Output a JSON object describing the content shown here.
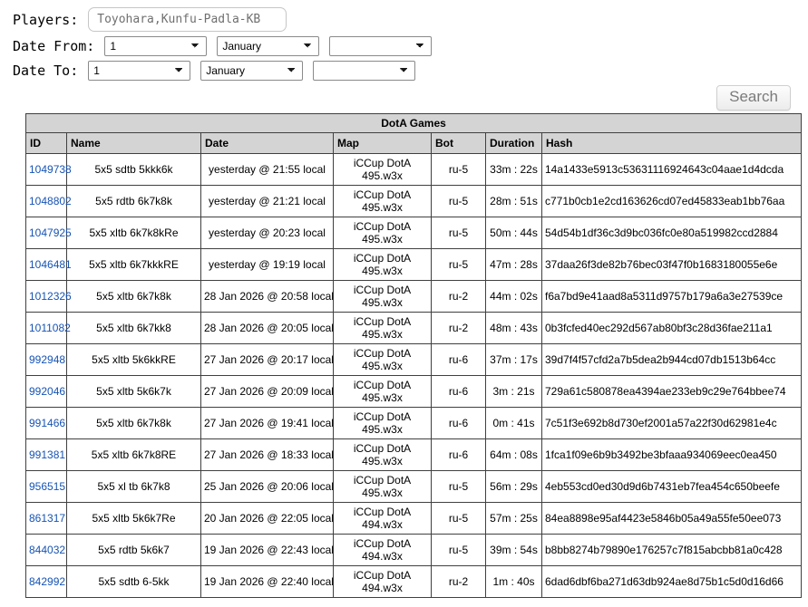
{
  "form": {
    "players": {
      "label": "Players:",
      "value": "Toyohara,Kunfu-Padla-KB"
    },
    "date_from": {
      "label": "Date From:",
      "day": "1",
      "month": "January",
      "year": ""
    },
    "date_to": {
      "label": "Date To:",
      "day": "1",
      "month": "January",
      "year": ""
    },
    "search_button": "Search"
  },
  "table": {
    "title": "DotA Games",
    "columns": [
      "ID",
      "Name",
      "Date",
      "Map",
      "Bot",
      "Duration",
      "Hash"
    ],
    "rows": [
      {
        "id": "1049738",
        "name": "5x5 sdtb 5kkk6k",
        "date": "yesterday @ 21:55 local",
        "map": "iCCup DotA 495.w3x",
        "bot": "ru-5",
        "duration": "33m : 22s",
        "hash": "14a1433e5913c53631116924643c04aae1d4dcda"
      },
      {
        "id": "1048802",
        "name": "5x5 rdtb 6k7k8k",
        "date": "yesterday @ 21:21 local",
        "map": "iCCup DotA 495.w3x",
        "bot": "ru-5",
        "duration": "28m : 51s",
        "hash": "c771b0cb1e2cd163626cd07ed45833eab1bb76aa"
      },
      {
        "id": "1047925",
        "name": "5x5 xltb 6k7k8kRe",
        "date": "yesterday @ 20:23 local",
        "map": "iCCup DotA 495.w3x",
        "bot": "ru-5",
        "duration": "50m : 44s",
        "hash": "54d54b1df36c3d9bc036fc0e80a519982ccd2884"
      },
      {
        "id": "1046481",
        "name": "5x5 xltb 6k7kkkRE",
        "date": "yesterday @ 19:19 local",
        "map": "iCCup DotA 495.w3x",
        "bot": "ru-5",
        "duration": "47m : 28s",
        "hash": "37daa26f3de82b76bec03f47f0b1683180055e6e"
      },
      {
        "id": "1012326",
        "name": "5x5 xltb 6k7k8k",
        "date": "28 Jan 2026 @ 20:58 local",
        "map": "iCCup DotA 495.w3x",
        "bot": "ru-2",
        "duration": "44m : 02s",
        "hash": "f6a7bd9e41aad8a5311d9757b179a6a3e27539ce"
      },
      {
        "id": "1011082",
        "name": "5x5 xltb 6k7kk8",
        "date": "28 Jan 2026 @ 20:05 local",
        "map": "iCCup DotA 495.w3x",
        "bot": "ru-2",
        "duration": "48m : 43s",
        "hash": "0b3fcfed40ec292d567ab80bf3c28d36fae211a1"
      },
      {
        "id": "992948",
        "name": "5x5 xltb 5k6kkRE",
        "date": "27 Jan 2026 @ 20:17 local",
        "map": "iCCup DotA 495.w3x",
        "bot": "ru-6",
        "duration": "37m : 17s",
        "hash": "39d7f4f57cfd2a7b5dea2b944cd07db1513b64cc"
      },
      {
        "id": "992046",
        "name": "5x5 xltb 5k6k7k",
        "date": "27 Jan 2026 @ 20:09 local",
        "map": "iCCup DotA 495.w3x",
        "bot": "ru-6",
        "duration": "3m : 21s",
        "hash": "729a61c580878ea4394ae233eb9c29e764bbee74"
      },
      {
        "id": "991466",
        "name": "5x5 xltb 6k7k8k",
        "date": "27 Jan 2026 @ 19:41 local",
        "map": "iCCup DotA 495.w3x",
        "bot": "ru-6",
        "duration": "0m : 41s",
        "hash": "7c51f3e692b8d730ef2001a57a22f30d62981e4c"
      },
      {
        "id": "991381",
        "name": "5x5 xltb 6k7k8RE",
        "date": "27 Jan 2026 @ 18:33 local",
        "map": "iCCup DotA 495.w3x",
        "bot": "ru-6",
        "duration": "64m : 08s",
        "hash": "1fca1f09e6b9b3492be3bfaaa934069eec0ea450"
      },
      {
        "id": "956515",
        "name": "5x5 xl tb 6k7k8",
        "date": "25 Jan 2026 @ 20:06 local",
        "map": "iCCup DotA 495.w3x",
        "bot": "ru-5",
        "duration": "56m : 29s",
        "hash": "4eb553cd0ed30d9d6b7431eb7fea454c650beefe"
      },
      {
        "id": "861317",
        "name": "5x5 xltb 5k6k7Re",
        "date": "20 Jan 2026 @ 22:05 local",
        "map": "iCCup DotA 494.w3x",
        "bot": "ru-5",
        "duration": "57m : 25s",
        "hash": "84ea8898e95af4423e5846b05a49a55fe50ee073"
      },
      {
        "id": "844032",
        "name": "5x5 rdtb 5k6k7",
        "date": "19 Jan 2026 @ 22:43 local",
        "map": "iCCup DotA 494.w3x",
        "bot": "ru-5",
        "duration": "39m : 54s",
        "hash": "b8bb8274b79890e176257c7f815abcbb81a0c428"
      },
      {
        "id": "842992",
        "name": "5x5 sdtb 6-5kk",
        "date": "19 Jan 2026 @ 22:40 local",
        "map": "iCCup DotA 494.w3x",
        "bot": "ru-2",
        "duration": "1m : 40s",
        "hash": "6dad6dbf6ba271d63db924ae8d75b1c5d0d16d66"
      }
    ]
  },
  "colors": {
    "link": "#1553b5",
    "header_bg": "#d4d4d4",
    "table_border": "#404040"
  }
}
